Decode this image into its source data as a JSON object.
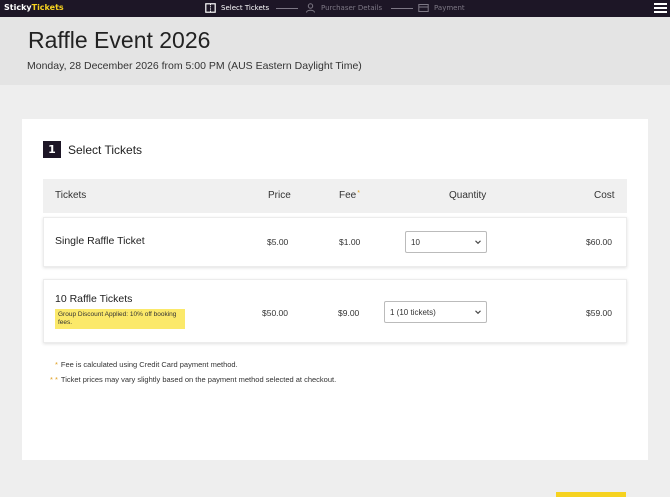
{
  "brand": {
    "logo_part1": "Sticky",
    "logo_part2": "Tickets",
    "accent_color": "#f6d21f",
    "bar_color": "#1d1626"
  },
  "steps": [
    {
      "label": "Select Tickets",
      "icon": "ticket-icon",
      "active": true
    },
    {
      "label": "Purchaser Details",
      "icon": "user-icon",
      "active": false
    },
    {
      "label": "Payment",
      "icon": "card-icon",
      "active": false
    }
  ],
  "event": {
    "title": "Raffle Event 2026",
    "date_line": "Monday, 28 December 2026 from 5:00 PM (AUS Eastern Daylight Time)"
  },
  "section": {
    "number": "1",
    "title": "Select Tickets"
  },
  "table": {
    "col_tickets": "Tickets",
    "col_price": "Price",
    "col_fee": "Fee",
    "col_fee_mark": "*",
    "col_quantity": "Quantity",
    "col_cost": "Cost"
  },
  "tickets": [
    {
      "name": "Single Raffle Ticket",
      "price": "$5.00",
      "fee": "$1.00",
      "quantity": "10",
      "cost": "$60.00"
    },
    {
      "name": "10 Raffle Tickets",
      "price": "$50.00",
      "fee": "$9.00",
      "quantity": "1 (10 tickets)",
      "cost": "$59.00",
      "discount": "Group Discount Applied: 10% off booking fees."
    }
  ],
  "notes": [
    {
      "mark": "*",
      "text": "Fee is calculated using Credit Card payment method."
    },
    {
      "mark": "* *",
      "text": "Ticket prices may vary slightly based on the payment method selected at checkout."
    }
  ]
}
